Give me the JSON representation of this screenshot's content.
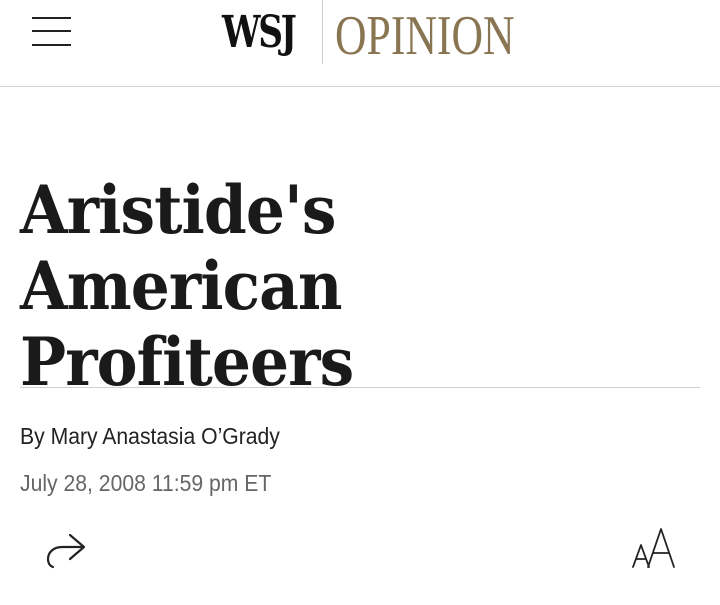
{
  "header": {
    "brand": "WSJ",
    "section": "OPINION",
    "menu_icon": "hamburger-menu-icon"
  },
  "article": {
    "headline_line1": "Aristide's American",
    "headline_line2": "Profiteers",
    "byline": "By Mary Anastasia O’Grady",
    "date": "July 28, 2008 11:59 pm ET"
  },
  "toolbar": {
    "share_icon": "share-icon",
    "text_size_icon": "text-size-icon"
  },
  "colors": {
    "opinion_gold": "#8a7553",
    "text": "#1a1a1a",
    "meta_gray": "#666666",
    "rule": "#cfcfcf"
  }
}
